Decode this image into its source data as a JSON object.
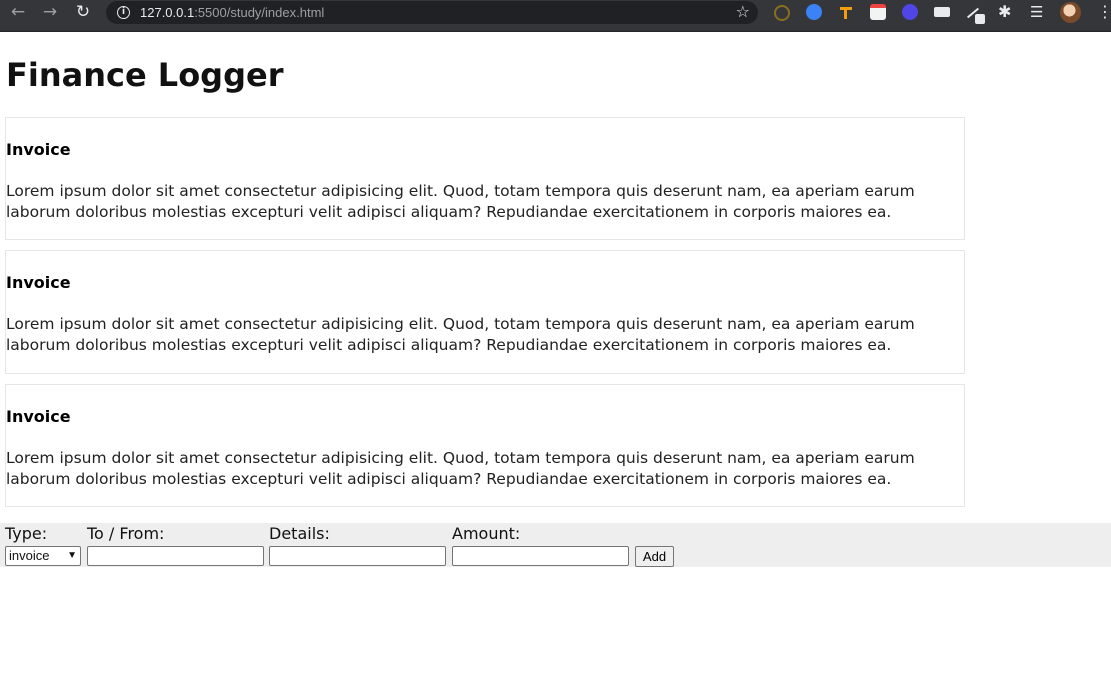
{
  "browser": {
    "url_host": "127.0.0.1",
    "url_rest": ":5500/study/index.html"
  },
  "page": {
    "title": "Finance Logger"
  },
  "cards": [
    {
      "heading": "Invoice",
      "body": "Lorem ipsum dolor sit amet consectetur adipisicing elit. Quod, totam tempora quis deserunt nam, ea aperiam earum laborum doloribus molestias excepturi velit adipisci aliquam? Repudiandae exercitationem in corporis maiores ea."
    },
    {
      "heading": "Invoice",
      "body": "Lorem ipsum dolor sit amet consectetur adipisicing elit. Quod, totam tempora quis deserunt nam, ea aperiam earum laborum doloribus molestias excepturi velit adipisci aliquam? Repudiandae exercitationem in corporis maiores ea."
    },
    {
      "heading": "Invoice",
      "body": "Lorem ipsum dolor sit amet consectetur adipisicing elit. Quod, totam tempora quis deserunt nam, ea aperiam earum laborum doloribus molestias excepturi velit adipisci aliquam? Repudiandae exercitationem in corporis maiores ea."
    }
  ],
  "form": {
    "type_label": "Type:",
    "type_value": "invoice",
    "to_from_label": "To / From:",
    "to_from_value": "",
    "details_label": "Details:",
    "details_value": "",
    "amount_label": "Amount:",
    "amount_value": "",
    "add_label": "Add"
  },
  "icons": {
    "back": "arrow-left-icon",
    "forward": "arrow-right-icon",
    "reload": "reload-icon",
    "site_info": "info-icon",
    "bookmark": "star-icon",
    "extensions": "puzzle-icon",
    "menu": "kebab-menu-icon"
  }
}
